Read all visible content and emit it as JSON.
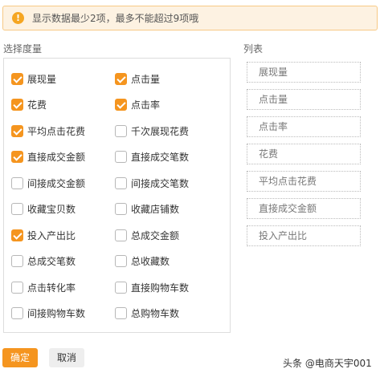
{
  "alert": {
    "icon": "!",
    "text": "显示数据最少2项，最多不能超过9项哦",
    "icon_name": "warning-icon"
  },
  "select_label": "选择度量",
  "list_label": "列表",
  "metrics": [
    {
      "label": "展现量",
      "checked": true
    },
    {
      "label": "点击量",
      "checked": true
    },
    {
      "label": "花费",
      "checked": true
    },
    {
      "label": "点击率",
      "checked": true
    },
    {
      "label": "平均点击花费",
      "checked": true
    },
    {
      "label": "千次展现花费",
      "checked": false
    },
    {
      "label": "直接成交金额",
      "checked": true
    },
    {
      "label": "直接成交笔数",
      "checked": false
    },
    {
      "label": "间接成交金额",
      "checked": false
    },
    {
      "label": "间接成交笔数",
      "checked": false
    },
    {
      "label": "收藏宝贝数",
      "checked": false
    },
    {
      "label": "收藏店铺数",
      "checked": false
    },
    {
      "label": "投入产出比",
      "checked": true
    },
    {
      "label": "总成交金额",
      "checked": false
    },
    {
      "label": "总成交笔数",
      "checked": false
    },
    {
      "label": "总收藏数",
      "checked": false
    },
    {
      "label": "点击转化率",
      "checked": false
    },
    {
      "label": "直接购物车数",
      "checked": false
    },
    {
      "label": "间接购物车数",
      "checked": false
    },
    {
      "label": "总购物车数",
      "checked": false
    }
  ],
  "list_items": [
    "展现量",
    "点击量",
    "点击率",
    "花费",
    "平均点击花费",
    "直接成交金额",
    "投入产出比"
  ],
  "buttons": {
    "ok": "确定",
    "cancel": "取消"
  },
  "watermark": "头条 @电商天宇001",
  "colors": {
    "accent": "#f5951f",
    "alert_bg": "#fdf2e2",
    "alert_border": "#f7c985"
  }
}
